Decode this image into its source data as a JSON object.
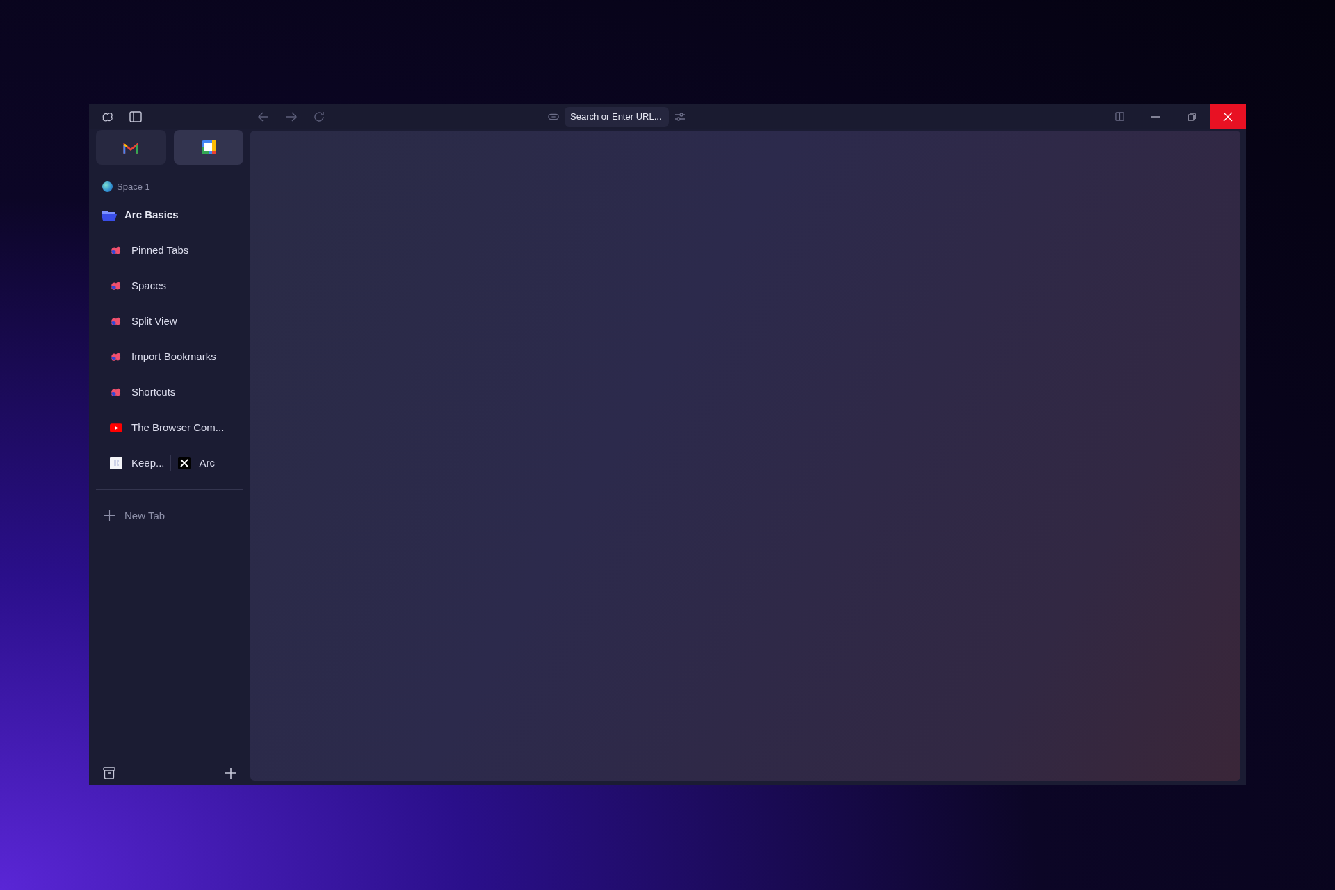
{
  "toolbar": {
    "address_placeholder": "Search or Enter URL..."
  },
  "pinned_apps": [
    {
      "kind": "mail",
      "selected": false
    },
    {
      "kind": "calendar",
      "selected": true
    }
  ],
  "space": {
    "name": "Space 1"
  },
  "folder": {
    "name": "Arc Basics",
    "expanded": true
  },
  "tabs": [
    {
      "kind": "arc",
      "title": "Pinned Tabs"
    },
    {
      "kind": "arc",
      "title": "Spaces"
    },
    {
      "kind": "arc",
      "title": "Split View"
    },
    {
      "kind": "arc",
      "title": "Import Bookmarks"
    },
    {
      "kind": "arc",
      "title": "Shortcuts"
    },
    {
      "kind": "video",
      "title": "The Browser Com..."
    }
  ],
  "split_tab": [
    {
      "kind": "notes",
      "title": "Keep..."
    },
    {
      "kind": "x",
      "title": "Arc"
    }
  ],
  "new_tab": {
    "label": "New Tab"
  }
}
